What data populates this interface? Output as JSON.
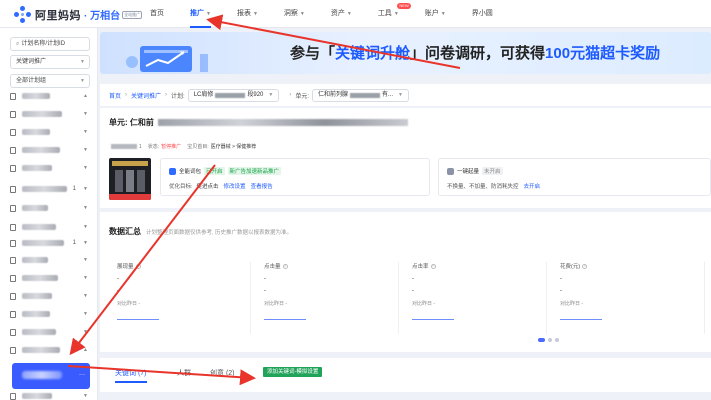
{
  "brand": {
    "name": "阿里妈妈",
    "product": "· 万相台",
    "badge": "全站推广"
  },
  "nav": [
    {
      "label": "首页",
      "caret": false
    },
    {
      "label": "推广",
      "caret": true,
      "active": true
    },
    {
      "label": "报表",
      "caret": true
    },
    {
      "label": "洞察",
      "caret": true
    },
    {
      "label": "资产",
      "caret": true
    },
    {
      "label": "工具",
      "caret": true,
      "badge": "NEW"
    },
    {
      "label": "账户",
      "caret": true
    },
    {
      "label": "界小圆",
      "caret": false
    }
  ],
  "sidebar": {
    "search_placeholder": "计划名称/计划ID",
    "filter1": "关键词推广",
    "filter2": "全部计划组",
    "item_counts": [
      "1",
      "1"
    ]
  },
  "banner": {
    "text_pre": "参与「",
    "text_highlight": "关键词升舱",
    "text_mid": "」问卷调研，可获得",
    "text_prize": "100元猫超卡奖励"
  },
  "breadcrumb": {
    "home": "首页",
    "section": "关键词推广",
    "plan_label": "计划:",
    "plan_value_prefix": "LC肩修",
    "plan_value_suffix": "段920",
    "unit_label": "单元:",
    "unit_value_prefix": "仁和前列腺",
    "unit_value_suffix": "有..."
  },
  "unit": {
    "title_prefix": "单元:",
    "title_name": "仁和前",
    "id_suffix": "1",
    "status_label": "状态:",
    "status_value": "暂停推广",
    "pos_label": "宝贝首目:",
    "category": "医疗器械 > 保健推荐",
    "opt1": {
      "title": "全能词包",
      "tag1": "已开启",
      "tag2": "新广告加速新品推广",
      "goal_label": "优化目标:",
      "goal_value": "促进点击",
      "link1": "修改设置",
      "link2": "查看报告"
    },
    "opt2": {
      "title": "一键起量",
      "tag": "未开启",
      "desc": "不换量、不加量、防消耗失控",
      "link": "去开启"
    }
  },
  "summary": {
    "title": "数据汇总",
    "note": "计划整理页面数据仅供参考, 历史推广数据以报表数据为准。",
    "metrics": [
      {
        "name": "展现量",
        "value": "-",
        "value2": "-",
        "compare": "对比昨日 -"
      },
      {
        "name": "点击量",
        "value": "-",
        "value2": "-",
        "compare": "对比昨日 -"
      },
      {
        "name": "点击率",
        "value": "-",
        "value2": "-",
        "compare": "对比昨日 -"
      },
      {
        "name": "花费(元)",
        "value": "-",
        "value2": "-",
        "compare": "对比昨日 -"
      }
    ]
  },
  "tabs": {
    "tab1": "关键词 (7)",
    "tab2": "人群",
    "tab3": "创意 (2)",
    "button": "添加关键词-模拟设置"
  },
  "colors": {
    "accent": "#1d5bff",
    "annotation": "#e8342a",
    "selected_plan": "#3a5cff"
  }
}
